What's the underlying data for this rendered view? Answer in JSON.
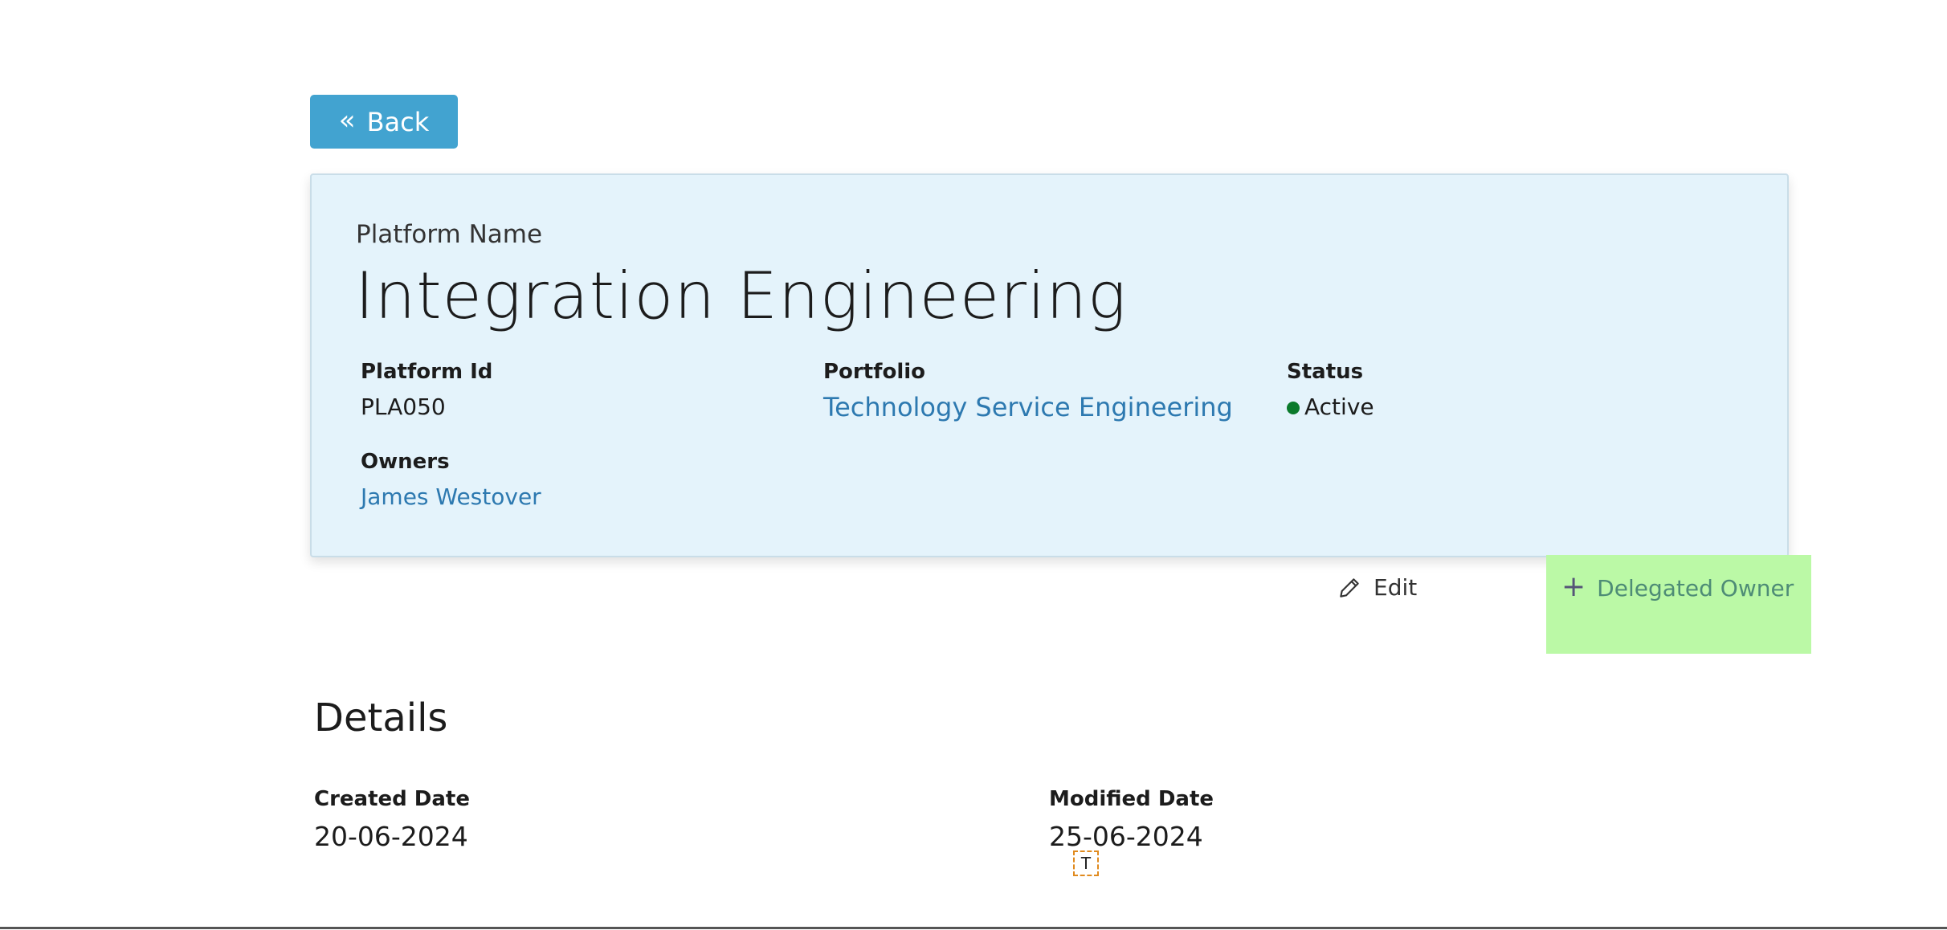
{
  "back_button": {
    "label": "Back"
  },
  "card": {
    "label": "Platform Name",
    "name": "Integration Engineering",
    "fields": {
      "platform_id": {
        "label": "Platform Id",
        "value": "PLA050"
      },
      "portfolio": {
        "label": "Portfolio",
        "value": "Technology Service Engineering"
      },
      "status": {
        "label": "Status",
        "value": "Active",
        "color": "#0a7a2b"
      },
      "owners": {
        "label": "Owners",
        "value": "James Westover"
      }
    }
  },
  "actions": {
    "edit_label": "Edit",
    "delegated_owner_label": "Delegated Owner"
  },
  "details": {
    "title": "Details",
    "created_label": "Created Date",
    "created_value": "20-06-2024",
    "modified_label": "Modified Date",
    "modified_value": "25-06-2024"
  },
  "text_marker": "T",
  "colors": {
    "accent": "#42a3d0",
    "card_bg": "#e4f3fb",
    "link": "#2d79b0",
    "highlight": "#bbf9a6"
  }
}
